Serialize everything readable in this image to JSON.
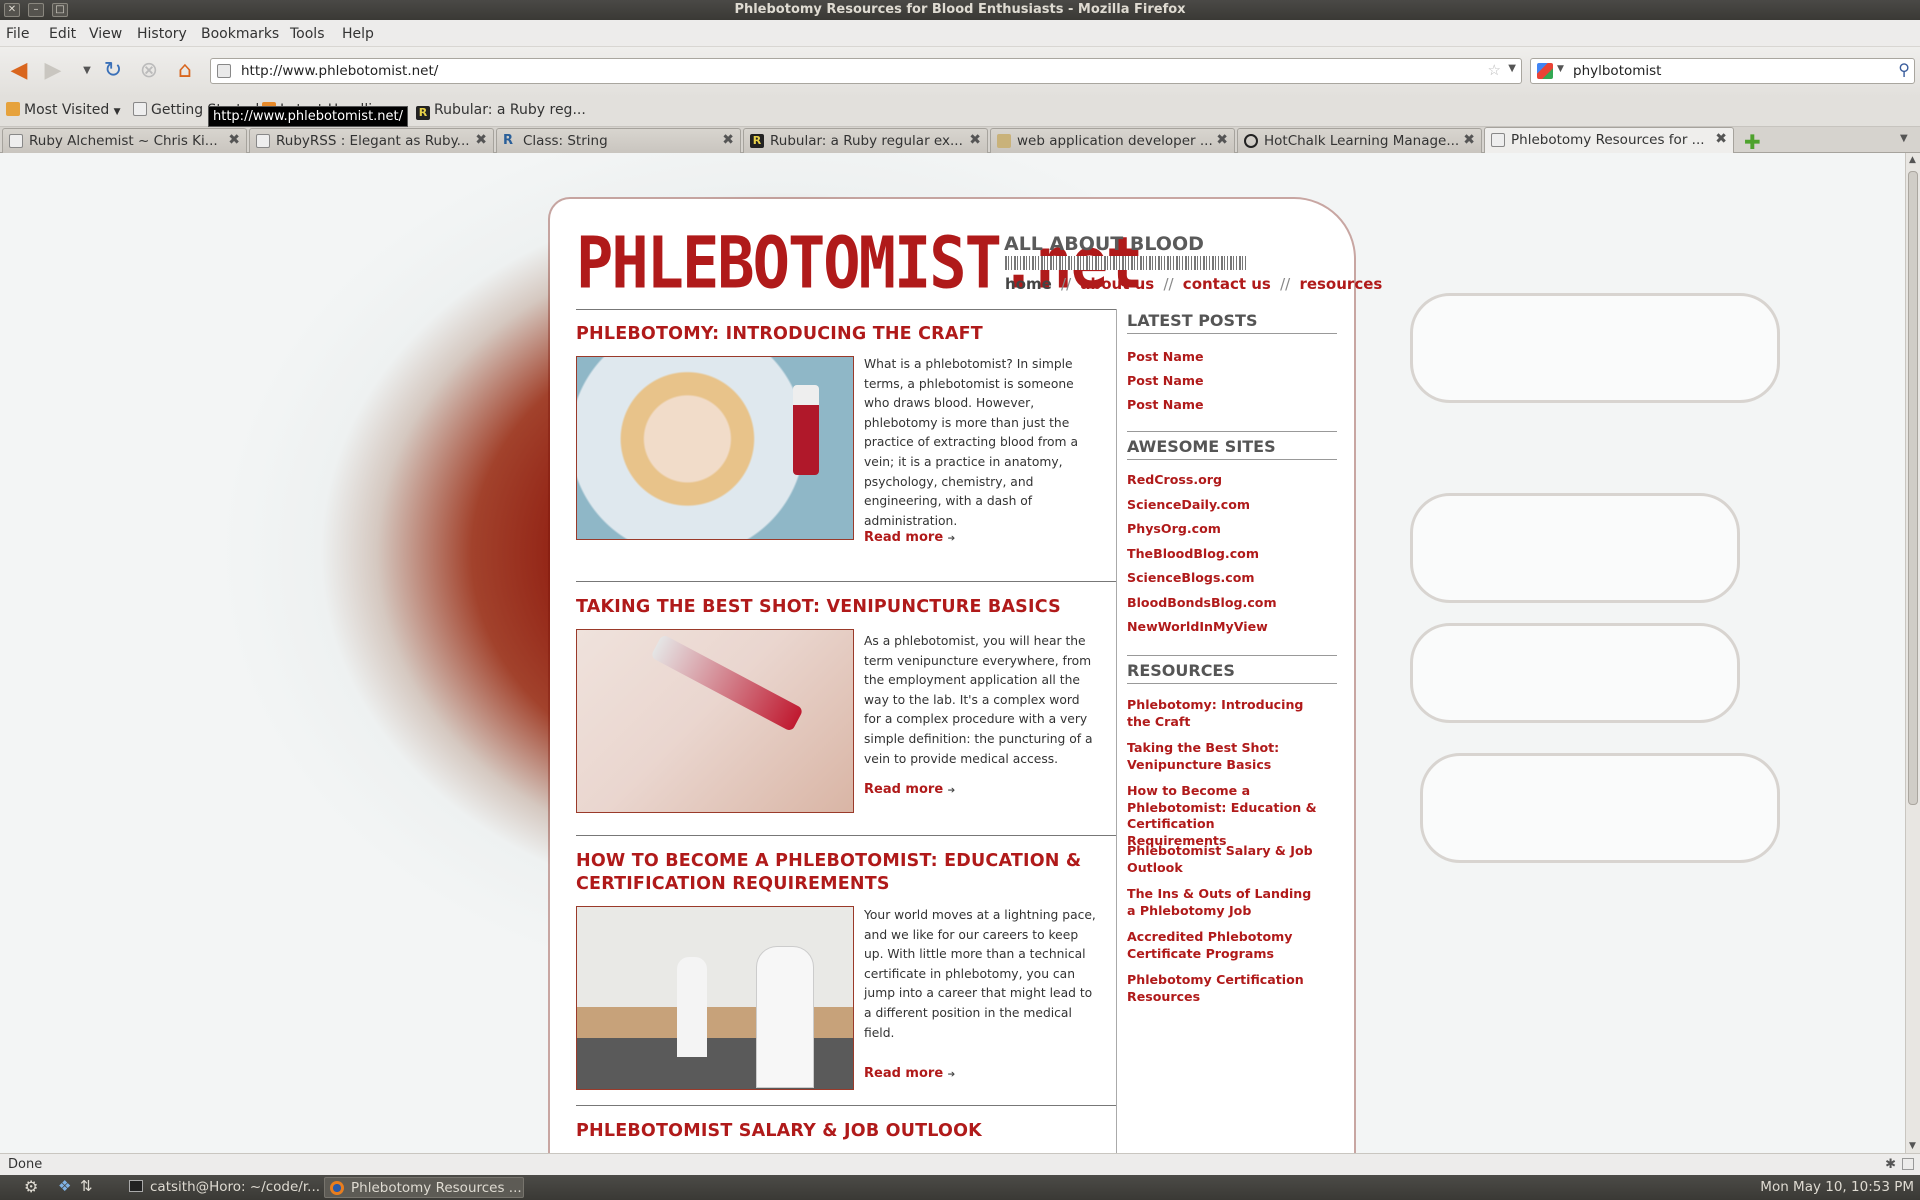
{
  "window": {
    "title": "Phlebotomy Resources for Blood Enthusiasts - Mozilla Firefox"
  },
  "menu": [
    "File",
    "Edit",
    "View",
    "History",
    "Bookmarks",
    "Tools",
    "Help"
  ],
  "navbar": {
    "url": "http://www.phlebotomist.net/",
    "search_query": "phylbotomist"
  },
  "bookmarks": {
    "most_visited": "Most Visited",
    "getting_started": "Getting Started",
    "latest_headlines": "Latest Headlines",
    "rubular": "Rubular: a Ruby reg..."
  },
  "tooltip": "http://www.phlebotomist.net/",
  "tabs": [
    {
      "label": "Ruby Alchemist ~ Chris Ki..."
    },
    {
      "label": "RubyRSS : Elegant as Ruby..."
    },
    {
      "label": "Class: String"
    },
    {
      "label": "Rubular: a Ruby regular ex..."
    },
    {
      "label": "web application developer ..."
    },
    {
      "label": "HotChalk Learning Manage..."
    },
    {
      "label": "Phlebotomy Resources for ..."
    }
  ],
  "site": {
    "logo": "PHLEBOTOMIST.net",
    "tagline": "ALL ABOUT BLOOD",
    "nav": {
      "home": "home",
      "about": "about us",
      "contact": "contact us",
      "resources": "resources",
      "sep": "//"
    }
  },
  "posts": [
    {
      "title": "PHLEBOTOMY: INTRODUCING THE CRAFT",
      "excerpt": "What is a phlebotomist? In simple terms, a phlebotomist is someone who draws blood. However, phlebotomy is more than just the practice of extracting blood from a vein; it is a practice in anatomy, psychology, chemistry, and engineering, with a dash of administration.",
      "more": "Read more"
    },
    {
      "title": "TAKING THE BEST SHOT: VENIPUNCTURE BASICS",
      "excerpt": "As a phlebotomist, you will hear the term venipuncture everywhere, from the employment application all the way to the lab. It's a complex word for a complex procedure with a very simple definition: the puncturing of a vein to provide medical access.",
      "more": "Read more"
    },
    {
      "title": "HOW TO BECOME A PHLEBOTOMIST: EDUCATION & CERTIFICATION REQUIREMENTS",
      "excerpt": "Your world moves at a lightning pace, and we like for our careers to keep up. With little more than a technical certificate in phlebotomy, you can jump into a career that might lead to a different position in the medical field.",
      "more": "Read more"
    },
    {
      "title": "PHLEBOTOMIST SALARY & JOB OUTLOOK"
    }
  ],
  "sidebar": {
    "latest_title": "LATEST POSTS",
    "latest": [
      "Post Name",
      "Post Name",
      "Post Name"
    ],
    "awesome_title": "AWESOME SITES",
    "awesome": [
      "RedCross.org",
      "ScienceDaily.com",
      "PhysOrg.com",
      "TheBloodBlog.com",
      "ScienceBlogs.com",
      "BloodBondsBlog.com",
      "NewWorldInMyView"
    ],
    "resources_title": "RESOURCES",
    "resources": [
      "Phlebotomy: Introducing the Craft",
      "Taking the Best Shot: Venipuncture Basics",
      "How to Become a Phlebotomist: Education & Certification Requirements",
      "Phlebotomist Salary & Job Outlook",
      "The Ins & Outs of Landing a Phlebotomy Job",
      "Accredited Phlebotomy Certificate Programs",
      "Phlebotomy Certification Resources"
    ]
  },
  "status": "Done",
  "panel": {
    "task1": "catsith@Horo: ~/code/r...",
    "task2": "Phlebotomy Resources ...",
    "clock": "Mon May 10, 10:53 PM"
  }
}
